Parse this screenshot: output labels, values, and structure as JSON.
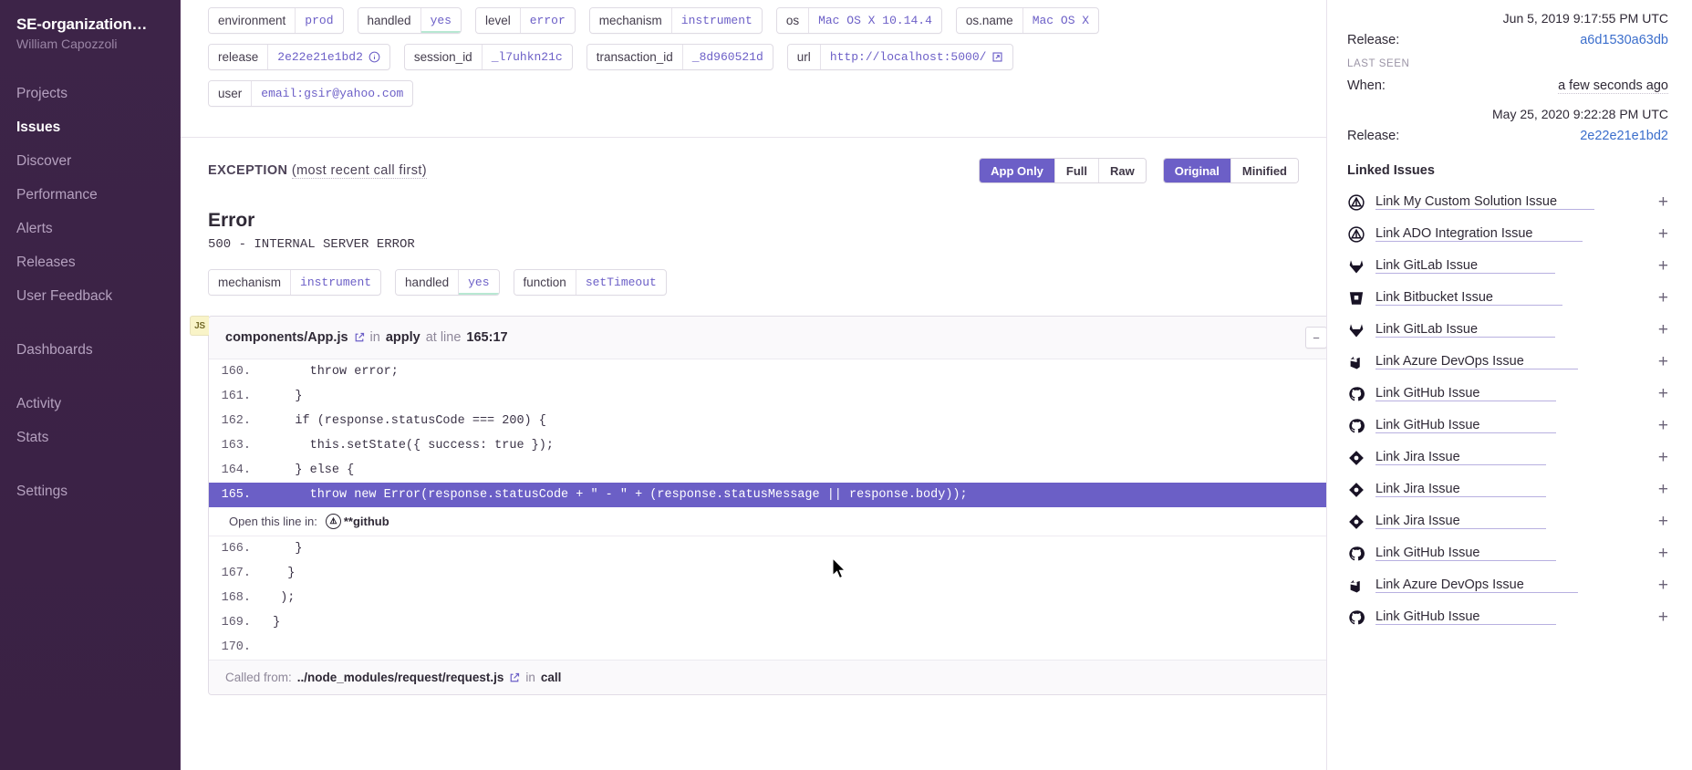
{
  "sidebar": {
    "org_name": "SE-organization…",
    "user_name": "William Capozzoli",
    "groups": [
      {
        "items": [
          {
            "label": "Projects",
            "active": false
          },
          {
            "label": "Issues",
            "active": true
          },
          {
            "label": "Discover",
            "active": false
          },
          {
            "label": "Performance",
            "active": false
          },
          {
            "label": "Alerts",
            "active": false
          },
          {
            "label": "Releases",
            "active": false
          },
          {
            "label": "User Feedback",
            "active": false
          }
        ]
      },
      {
        "items": [
          {
            "label": "Dashboards",
            "active": false
          }
        ]
      },
      {
        "items": [
          {
            "label": "Activity",
            "active": false
          },
          {
            "label": "Stats",
            "active": false
          }
        ]
      },
      {
        "items": [
          {
            "label": "Settings",
            "active": false
          }
        ]
      }
    ]
  },
  "tags": {
    "rows": [
      [
        {
          "key": "environment",
          "value": "prod",
          "icon": null,
          "underline": false
        },
        {
          "key": "handled",
          "value": "yes",
          "icon": null,
          "underline": true
        },
        {
          "key": "level",
          "value": "error",
          "icon": null,
          "underline": false
        },
        {
          "key": "mechanism",
          "value": "instrument",
          "icon": null,
          "underline": false
        },
        {
          "key": "os",
          "value": "Mac OS X 10.14.4",
          "icon": null,
          "underline": false
        },
        {
          "key": "os.name",
          "value": "Mac OS X",
          "icon": null,
          "underline": false
        }
      ],
      [
        {
          "key": "release",
          "value": "2e22e21e1bd2",
          "icon": "info-icon",
          "underline": false
        },
        {
          "key": "session_id",
          "value": "_l7uhkn21c",
          "icon": null,
          "underline": false
        },
        {
          "key": "transaction_id",
          "value": "_8d960521d",
          "icon": null,
          "underline": false
        },
        {
          "key": "url",
          "value": "http://localhost:5000/",
          "icon": "external-link-icon",
          "underline": false
        }
      ],
      [
        {
          "key": "user",
          "value": "email:gsir@yahoo.com",
          "icon": null,
          "underline": false
        }
      ]
    ]
  },
  "exception": {
    "title_word": "EXCEPTION",
    "title_sub": "(most recent call first)",
    "view_group": [
      {
        "label": "App Only",
        "selected": true
      },
      {
        "label": "Full",
        "selected": false
      },
      {
        "label": "Raw",
        "selected": false
      }
    ],
    "source_group": [
      {
        "label": "Original",
        "selected": true
      },
      {
        "label": "Minified",
        "selected": false
      }
    ],
    "error_title": "Error",
    "error_detail": "500 - INTERNAL SERVER ERROR",
    "error_tags": [
      {
        "key": "mechanism",
        "value": "instrument",
        "underline": false
      },
      {
        "key": "handled",
        "value": "yes",
        "underline": true
      },
      {
        "key": "function",
        "value": "setTimeout",
        "underline": false
      }
    ]
  },
  "frame": {
    "badge": "JS",
    "file": "components/App.js",
    "in_word": "in",
    "function": "apply",
    "at_line_word": "at line",
    "line_col": "165:17",
    "collapse_glyph": "−",
    "lines": [
      {
        "no": "160.",
        "code": "      throw error;",
        "highlight": false
      },
      {
        "no": "161.",
        "code": "    }",
        "highlight": false
      },
      {
        "no": "162.",
        "code": "    if (response.statusCode === 200) {",
        "highlight": false
      },
      {
        "no": "163.",
        "code": "      this.setState({ success: true });",
        "highlight": false
      },
      {
        "no": "164.",
        "code": "    } else {",
        "highlight": false
      },
      {
        "no": "165.",
        "code": "      throw new Error(response.statusCode + \" - \" + (response.statusMessage || response.body));",
        "highlight": true
      },
      {
        "no": "166.",
        "code": "    }",
        "highlight": false
      },
      {
        "no": "167.",
        "code": "   }",
        "highlight": false
      },
      {
        "no": "168.",
        "code": "  );",
        "highlight": false
      },
      {
        "no": "169.",
        "code": " }",
        "highlight": false
      },
      {
        "no": "170.",
        "code": "",
        "highlight": false
      }
    ],
    "open_line_label": "Open this line in:",
    "open_line_provider": "**github",
    "called_from_label": "Called from:",
    "called_from_path": "../node_modules/request/request.js",
    "called_from_in": "in",
    "called_from_fn": "call"
  },
  "rightbar": {
    "first_seen_ts": "Jun 5, 2019 9:17:55 PM UTC",
    "first_release_label": "Release:",
    "first_release_value": "a6d1530a63db",
    "last_seen_label": "LAST SEEN",
    "when_label": "When:",
    "when_value": "a few seconds ago",
    "last_seen_ts": "May 25, 2020 9:22:28 PM UTC",
    "last_release_label": "Release:",
    "last_release_value": "2e22e21e1bd2",
    "linked_issues_title": "Linked Issues",
    "plus_glyph": "+",
    "linked_issues": [
      {
        "label": "Link My Custom Solution Issue",
        "icon": "sentry-icon"
      },
      {
        "label": "Link ADO Integration Issue",
        "icon": "sentry-icon"
      },
      {
        "label": "Link GitLab Issue",
        "icon": "gitlab-icon"
      },
      {
        "label": "Link Bitbucket Issue",
        "icon": "bitbucket-icon"
      },
      {
        "label": "Link GitLab Issue",
        "icon": "gitlab-icon"
      },
      {
        "label": "Link Azure DevOps Issue",
        "icon": "azure-devops-icon"
      },
      {
        "label": "Link GitHub Issue",
        "icon": "github-icon"
      },
      {
        "label": "Link GitHub Issue",
        "icon": "github-icon"
      },
      {
        "label": "Link Jira Issue",
        "icon": "jira-icon"
      },
      {
        "label": "Link Jira Issue",
        "icon": "jira-icon"
      },
      {
        "label": "Link Jira Issue",
        "icon": "jira-icon"
      },
      {
        "label": "Link GitHub Issue",
        "icon": "github-icon"
      },
      {
        "label": "Link Azure DevOps Issue",
        "icon": "azure-devops-icon"
      },
      {
        "label": "Link GitHub Issue",
        "icon": "github-icon"
      }
    ]
  },
  "colors": {
    "accent": "#6c5fc7",
    "sidebar_bg": "#3b2346",
    "link": "#3b6ecc",
    "highlight_row": "#6b5fc6",
    "badge_yellow": "#f9f4c8"
  }
}
